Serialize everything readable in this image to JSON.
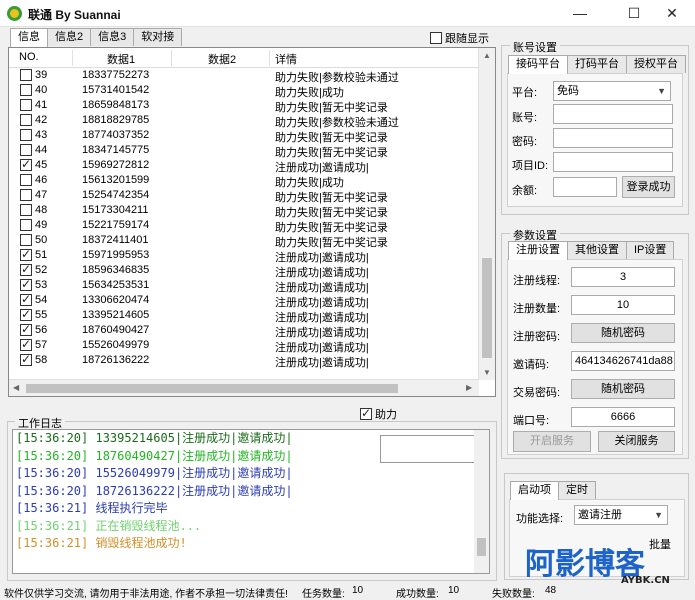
{
  "window": {
    "title": "联通 By Suannai",
    "minimize": "—",
    "maximize": "☐",
    "close": "✕"
  },
  "left_tabs": [
    "信息",
    "信息2",
    "信息3",
    "软对接"
  ],
  "follow_label": "跟随显示",
  "list": {
    "headers": {
      "no": "NO.",
      "data1": "数据1",
      "data2": "数据2",
      "detail": "详情"
    },
    "rows": [
      {
        "checked": false,
        "no": "39",
        "data1": "18337752273",
        "detail": "助力失败|参数校验未通过"
      },
      {
        "checked": false,
        "no": "40",
        "data1": "15731401542",
        "detail": "助力失败|成功"
      },
      {
        "checked": false,
        "no": "41",
        "data1": "18659848173",
        "detail": "助力失败|暂无中奖记录"
      },
      {
        "checked": false,
        "no": "42",
        "data1": "18818829785",
        "detail": "助力失败|参数校验未通过"
      },
      {
        "checked": false,
        "no": "43",
        "data1": "18774037352",
        "detail": "助力失败|暂无中奖记录"
      },
      {
        "checked": false,
        "no": "44",
        "data1": "18347145775",
        "detail": "助力失败|暂无中奖记录"
      },
      {
        "checked": true,
        "no": "45",
        "data1": "15969272812",
        "detail": "注册成功|邀请成功|"
      },
      {
        "checked": false,
        "no": "46",
        "data1": "15613201599",
        "detail": "助力失败|成功"
      },
      {
        "checked": false,
        "no": "47",
        "data1": "15254742354",
        "detail": "助力失败|暂无中奖记录"
      },
      {
        "checked": false,
        "no": "48",
        "data1": "15173304211",
        "detail": "助力失败|暂无中奖记录"
      },
      {
        "checked": false,
        "no": "49",
        "data1": "15221759174",
        "detail": "助力失败|暂无中奖记录"
      },
      {
        "checked": false,
        "no": "50",
        "data1": "18372411401",
        "detail": "助力失败|暂无中奖记录"
      },
      {
        "checked": true,
        "no": "51",
        "data1": "15971995953",
        "detail": "注册成功|邀请成功|"
      },
      {
        "checked": true,
        "no": "52",
        "data1": "18596346835",
        "detail": "注册成功|邀请成功|"
      },
      {
        "checked": true,
        "no": "53",
        "data1": "15634253531",
        "detail": "注册成功|邀请成功|"
      },
      {
        "checked": true,
        "no": "54",
        "data1": "13306620474",
        "detail": "注册成功|邀请成功|"
      },
      {
        "checked": true,
        "no": "55",
        "data1": "13395214605",
        "detail": "注册成功|邀请成功|"
      },
      {
        "checked": true,
        "no": "56",
        "data1": "18760490427",
        "detail": "注册成功|邀请成功|"
      },
      {
        "checked": true,
        "no": "57",
        "data1": "15526049979",
        "detail": "注册成功|邀请成功|"
      },
      {
        "checked": true,
        "no": "58",
        "data1": "18726136222",
        "detail": "注册成功|邀请成功|"
      }
    ]
  },
  "log": {
    "title": "工作日志",
    "assist_label": "助力",
    "lines": [
      {
        "text": "[15:36:20] 13395214605|注册成功|邀请成功|",
        "color": "#1a6b1a"
      },
      {
        "text": "[15:36:20] 18760490427|注册成功|邀请成功|",
        "color": "#22b522"
      },
      {
        "text": "[15:36:20] 15526049979|注册成功|邀请成功|",
        "color": "#2a3cb8"
      },
      {
        "text": "[15:36:20] 18726136222|注册成功|邀请成功|",
        "color": "#2a3cb8"
      },
      {
        "text": "[15:36:21] 线程执行完毕",
        "color": "#2a3cb8"
      },
      {
        "text": "[15:36:21] 正在销毁线程池...",
        "color": "#6fd16f"
      },
      {
        "text": "[15:36:21] 销毁线程池成功!",
        "color": "#d0902a"
      }
    ]
  },
  "status": {
    "notice": "软件仅供学习交流, 请勿用于非法用途, 作者不承担一切法律责任!",
    "task_label": "任务数量:",
    "task_value": "10",
    "success_label": "成功数量:",
    "success_value": "10",
    "fail_label": "失败数量:",
    "fail_value": "48"
  },
  "account": {
    "title": "账号设置",
    "tabs": [
      "接码平台",
      "打码平台",
      "授权平台"
    ],
    "platform_label": "平台:",
    "platform_value": "免码",
    "account_label": "账号:",
    "password_label": "密码:",
    "project_label": "项目ID:",
    "balance_label": "余额:",
    "login_button": "登录成功"
  },
  "params": {
    "title": "参数设置",
    "tabs": [
      "注册设置",
      "其他设置",
      "IP设置"
    ],
    "threads_label": "注册线程:",
    "threads_value": "3",
    "count_label": "注册数量:",
    "count_value": "10",
    "reg_pwd_label": "注册密码:",
    "reg_pwd_value": "随机密码",
    "invite_label": "邀请码:",
    "invite_value": "464134626741da88",
    "trade_pwd_label": "交易密码:",
    "trade_pwd_value": "随机密码",
    "port_label": "端口号:",
    "port_value": "6666",
    "start_service": "开启服务",
    "stop_service": "关闭服务"
  },
  "startup": {
    "tabs": [
      "启动项",
      "定时"
    ],
    "function_label": "功能选择:",
    "function_value": "邀请注册",
    "batch_label": "批量"
  },
  "watermark": {
    "cn": "阿影博客",
    "en": "AYBK.CN"
  }
}
